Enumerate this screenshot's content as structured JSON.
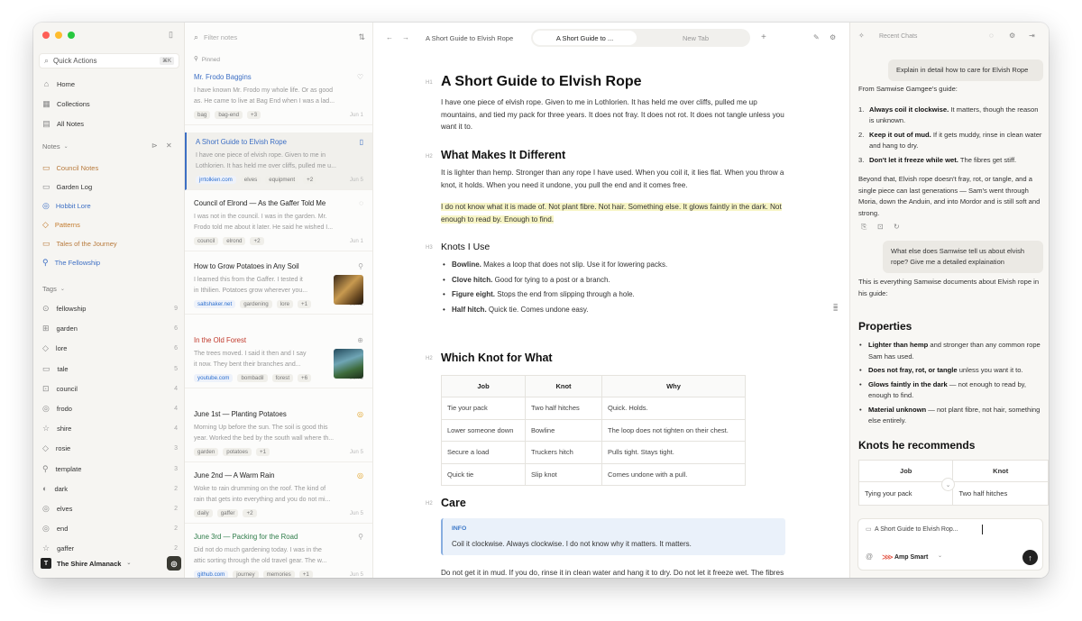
{
  "sidebar": {
    "quick_actions": "Quick Actions",
    "quick_actions_kbd": "⌘K",
    "nav": [
      {
        "label": "Home",
        "icon": "home-icon"
      },
      {
        "label": "Collections",
        "icon": "collections-icon"
      },
      {
        "label": "All Notes",
        "icon": "notes-icon"
      }
    ],
    "notes_section": "Notes",
    "notes": [
      {
        "label": "Council Notes",
        "color": "#b87a3c"
      },
      {
        "label": "Garden Log",
        "color": "#333333"
      },
      {
        "label": "Hobbit Lore",
        "color": "#3d6fc4"
      },
      {
        "label": "Patterns",
        "color": "#c2792b"
      },
      {
        "label": "Tales of the Journey",
        "color": "#b87a3c"
      },
      {
        "label": "The Fellowship",
        "color": "#3d6fc4"
      }
    ],
    "tags_section": "Tags",
    "tags": [
      {
        "label": "fellowship",
        "count": "9"
      },
      {
        "label": "garden",
        "count": "6"
      },
      {
        "label": "lore",
        "count": "6"
      },
      {
        "label": "tale",
        "count": "5"
      },
      {
        "label": "council",
        "count": "4"
      },
      {
        "label": "frodo",
        "count": "4"
      },
      {
        "label": "shire",
        "count": "4"
      },
      {
        "label": "rosie",
        "count": "3"
      },
      {
        "label": "template",
        "count": "3"
      },
      {
        "label": "dark",
        "count": "2"
      },
      {
        "label": "elves",
        "count": "2"
      },
      {
        "label": "end",
        "count": "2"
      },
      {
        "label": "gaffer",
        "count": "2"
      }
    ],
    "workspace": "The Shire Almanack",
    "workspace_initial": "T"
  },
  "list": {
    "filter_placeholder": "Filter notes",
    "pinned_label": "Pinned",
    "cards": [
      {
        "title": "Mr. Frodo Baggins",
        "title_color": "#3d6fc4",
        "preview1": "I have known Mr. Frodo my whole life. Or as good",
        "preview2": "as. He came to live at Bag End when I was a lad...",
        "chips": [
          "bag",
          "bag-end",
          "+3"
        ],
        "date": "Jun 1"
      },
      {
        "title": "A Short Guide to Elvish Rope",
        "title_color": "#3d6fc4",
        "preview1": "I have one piece of elvish rope. Given to me in",
        "preview2": "Lothlorien. It has held me over cliffs, pulled me u...",
        "chips": [
          "jrrtolkien.com",
          "elves",
          "equipment",
          "+2"
        ],
        "date": "Jun 5"
      },
      {
        "title": "Council of Elrond — As the Gaffer Told Me",
        "title_color": "#222222",
        "preview1": "I was not in the council. I was in the garden. Mr.",
        "preview2": "Frodo told me about it later. He said he wished I...",
        "chips": [
          "council",
          "elrond",
          "+2"
        ],
        "date": "Jun 1"
      },
      {
        "title": "How to Grow Potatoes in Any Soil",
        "title_color": "#222222",
        "preview1": "I learned this from the Gaffer. I tested it",
        "preview2": "in Ithilien. Potatoes grow wherever you...",
        "chips": [
          "saltshaker.net",
          "gardening",
          "lore",
          "+1"
        ],
        "date": "Jun 2"
      },
      {
        "title": "In the Old Forest",
        "title_color": "#c0392b",
        "preview1": "The trees moved. I said it then and I say",
        "preview2": "it now. They bent their branches and...",
        "chips": [
          "youtube.com",
          "bombadil",
          "forest",
          "+6"
        ],
        "date": "Jun 5"
      },
      {
        "title": "June 1st — Planting Potatoes",
        "title_color": "#222222",
        "preview1": "Morning Up before the sun. The soil is good this",
        "preview2": "year. Worked the bed by the south wall where th...",
        "chips": [
          "garden",
          "potatoes",
          "+1"
        ],
        "date": "Jun 5"
      },
      {
        "title": "June 2nd — A Warm Rain",
        "title_color": "#222222",
        "preview1": "Woke to rain drumming on the roof. The kind of",
        "preview2": "rain that gets into everything and you do not mi...",
        "chips": [
          "daily",
          "gaffer",
          "+2"
        ],
        "date": "Jun 5"
      },
      {
        "title": "June 3rd — Packing for the Road",
        "title_color": "#2f7d4a",
        "preview1": "Did not do much gardening today. I was in the",
        "preview2": "attic sorting through the old travel gear. The w...",
        "chips": [
          "github.com",
          "journey",
          "memories",
          "+1"
        ],
        "date": "Jun 5"
      }
    ]
  },
  "editor": {
    "breadcrumb": "A Short Guide to Elvish Rope",
    "tab_active": "A Short Guide to ...",
    "tab_inactive": "New Tab",
    "h1": "A Short Guide to Elvish Rope",
    "intro": "I have one piece of elvish rope. Given to me in Lothlorien. It has held me over cliffs, pulled me up mountains, and tied my pack for three years. It does not fray. It does not rot. It does not tangle unless you want it to.",
    "h2_different": "What Makes It Different",
    "different_p": "It is lighter than hemp. Stronger than any rope I have used. When you coil it, it lies flat. When you throw a knot, it holds. When you need it undone, you pull the end and it comes free.",
    "highlight": "I do not know what it is made of. Not plant fibre. Not hair. Something else. It glows faintly in the dark. Not enough to read by. Enough to find.",
    "h3_knots": "Knots I Use",
    "knots": [
      {
        "name": "Bowline.",
        "desc": "Makes a loop that does not slip. Use it for lowering packs."
      },
      {
        "name": "Clove hitch.",
        "desc": "Good for tying to a post or a branch."
      },
      {
        "name": "Figure eight.",
        "desc": "Stops the end from slipping through a hole."
      },
      {
        "name": "Half hitch.",
        "desc": "Quick tie. Comes undone easy."
      }
    ],
    "h2_which": "Which Knot for What",
    "table_headers": [
      "Job",
      "Knot",
      "Why"
    ],
    "table_rows": [
      [
        "Tie your pack",
        "Two half hitches",
        "Quick. Holds."
      ],
      [
        "Lower someone down",
        "Bowline",
        "The loop does not tighten on their chest."
      ],
      [
        "Secure a load",
        "Truckers hitch",
        "Pulls tight. Stays tight."
      ],
      [
        "Quick tie",
        "Slip knot",
        "Comes undone with a pull."
      ]
    ],
    "h2_care": "Care",
    "info_label": "INFO",
    "info_text": "Coil it clockwise. Always clockwise. I do not know why it matters. It matters.",
    "care_p": "Do not get it in mud. If you do, rinse it in clean water and hang it to dry. Do not let it freeze wet. The fibres get stiff.",
    "hl_h1": "H1",
    "hl_h2": "H2",
    "hl_h3": "H3"
  },
  "chat": {
    "title": "Recent Chats",
    "q1": "Explain in detail how to care for Elvish Rope",
    "a1_intro": "From Samwise Gamgee's guide:",
    "a1_list": [
      {
        "n": "1.",
        "b": "Always coil it clockwise.",
        "t": " It matters, though the reason is unknown."
      },
      {
        "n": "2.",
        "b": "Keep it out of mud.",
        "t": " If it gets muddy, rinse in clean water and hang to dry."
      },
      {
        "n": "3.",
        "b": "Don't let it freeze while wet.",
        "t": " The fibres get stiff."
      }
    ],
    "a1_outro": "Beyond that, Elvish rope doesn't fray, rot, or tangle, and a single piece can last generations — Sam's went through Moria, down the Anduin, and into Mordor and is still soft and strong.",
    "q2": "What else does Samwise tell us about elvish rope? Give me a detailed explaination",
    "a2_intro": "This is everything Samwise documents about Elvish rope in his guide:",
    "h_properties": "Properties",
    "properties": [
      {
        "b": "Lighter than hemp",
        "t": " and stronger than any common rope Sam has used."
      },
      {
        "b": "Does not fray, rot, or tangle",
        "t": " unless you want it to."
      },
      {
        "b": "Glows faintly in the dark",
        "t": " — not enough to read by, enough to find."
      },
      {
        "b": "Material unknown",
        "t": " — not plant fibre, not hair, something else entirely."
      }
    ],
    "h_knots": "Knots he recommends",
    "table_headers": [
      "Job",
      "Knot"
    ],
    "table_row": [
      "Tying your pack",
      "Two half hitches"
    ],
    "context_chip": "A Short Guide to Elvish Rop...",
    "model": "Amp Smart"
  }
}
